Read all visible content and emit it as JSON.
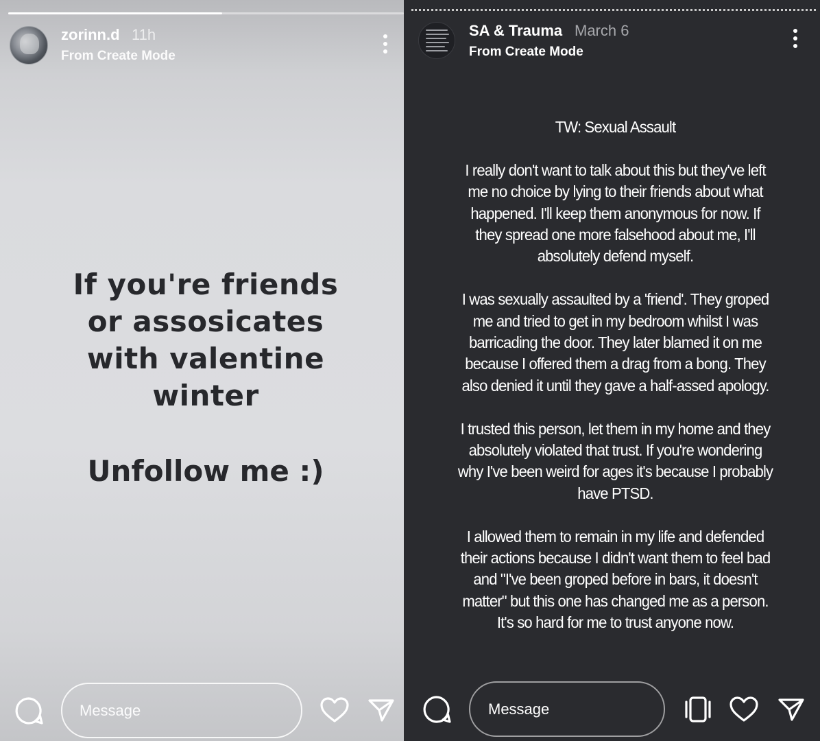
{
  "left_story": {
    "username": "zorinn.d",
    "time": "11h",
    "subtitle": "From Create Mode",
    "progress_fraction": 0.54,
    "text_lines": [
      "If you're friends",
      "or assosicates",
      "with valentine",
      "winter"
    ],
    "cta": "Unfollow me :)",
    "message_placeholder": "Message",
    "icons": [
      "comment-icon",
      "heart-icon",
      "send-icon",
      "more-icon"
    ]
  },
  "right_story": {
    "username": "SA & Trauma",
    "time": "March 6",
    "subtitle": "From Create Mode",
    "trigger_warning": "TW: Sexual Assault",
    "paragraphs": [
      "I really don't want to talk about this but they've left me no choice by lying to their friends about what happened. I'll keep them anonymous for now. If they spread one more falsehood about me, I'll absolutely defend myself.",
      "I was sexually assaulted by a 'friend'. They groped me and tried to get in my bedroom whilst I was barricading the door. They later blamed it on me because I offered them a drag from a bong. They also denied it until they gave a half-assed apology.",
      "I trusted this person, let them in my home and they absolutely violated that trust. If you're wondering why I've been weird for ages it's because I probably have PTSD.",
      "I allowed them to remain in my life and defended their actions because I didn't want them to feel bad and \"I've been groped before in bars, it doesn't matter\" but this one has changed me as a person. It's so hard for me to trust anyone now."
    ],
    "message_placeholder": "Message",
    "icons": [
      "comment-icon",
      "carousel-icon",
      "heart-icon",
      "send-icon",
      "more-icon"
    ]
  },
  "colors": {
    "left_text": "#27282c",
    "right_background": "#2a2b2f"
  }
}
